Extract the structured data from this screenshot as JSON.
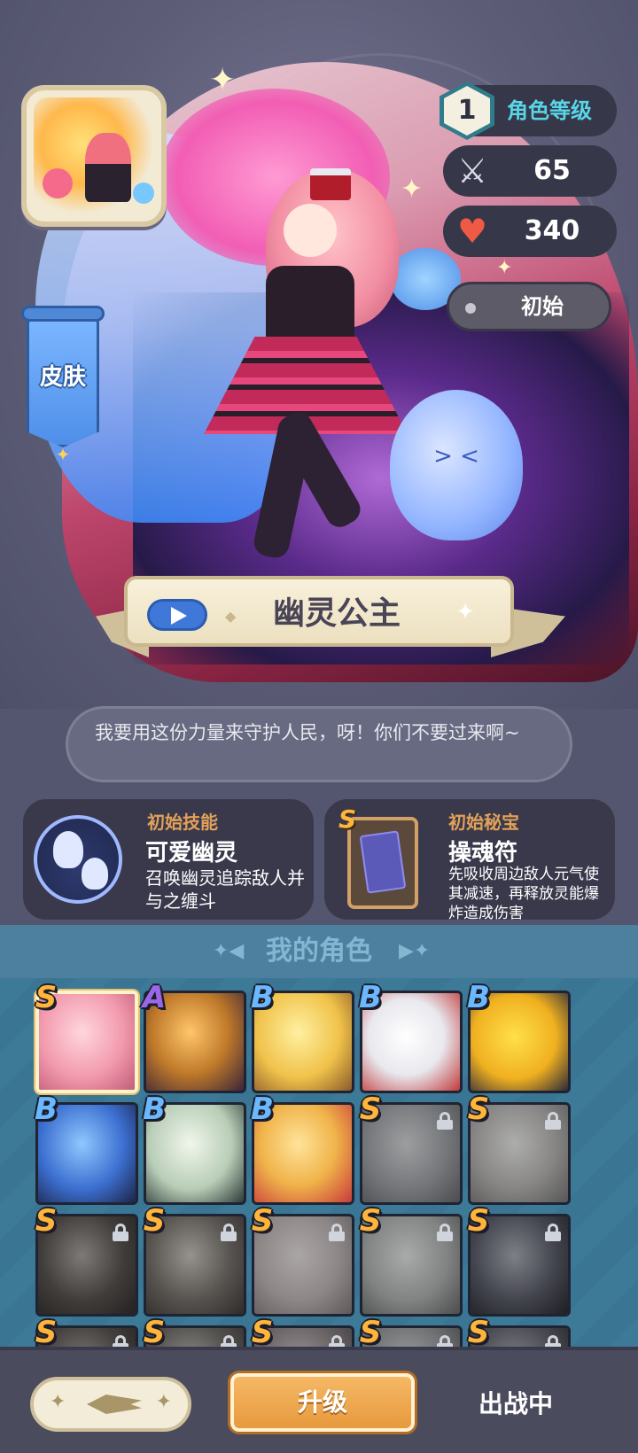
{
  "hero": {
    "level_number": "1",
    "level_label": "角色等级",
    "attack": "65",
    "hp": "340",
    "state": "初始",
    "skin_label": "皮肤",
    "name": "幽灵公主",
    "quote": "我要用这份力量来守护人民，呀！你们不要过来啊~"
  },
  "skill": {
    "label": "初始技能",
    "title": "可爱幽灵",
    "desc": "召唤幽灵追踪敌人并与之缠斗"
  },
  "treasure": {
    "label": "初始秘宝",
    "grade": "S",
    "title": "操魂符",
    "desc": "先吸收周边敌人元气使其减速，再释放灵能爆炸造成伤害"
  },
  "roster": {
    "title": "我的角色",
    "characters": [
      {
        "grade": "S",
        "locked": false,
        "selected": true
      },
      {
        "grade": "A",
        "locked": false,
        "selected": false
      },
      {
        "grade": "B",
        "locked": false,
        "selected": false
      },
      {
        "grade": "B",
        "locked": false,
        "selected": false
      },
      {
        "grade": "B",
        "locked": false,
        "selected": false
      },
      {
        "grade": "B",
        "locked": false,
        "selected": false
      },
      {
        "grade": "B",
        "locked": false,
        "selected": false
      },
      {
        "grade": "B",
        "locked": false,
        "selected": false
      },
      {
        "grade": "S",
        "locked": true,
        "selected": false
      },
      {
        "grade": "S",
        "locked": true,
        "selected": false
      },
      {
        "grade": "S",
        "locked": true,
        "selected": false
      },
      {
        "grade": "S",
        "locked": true,
        "selected": false
      },
      {
        "grade": "S",
        "locked": true,
        "selected": false
      },
      {
        "grade": "S",
        "locked": true,
        "selected": false
      },
      {
        "grade": "S",
        "locked": true,
        "selected": false
      },
      {
        "grade": "S",
        "locked": true,
        "selected": false
      },
      {
        "grade": "S",
        "locked": true,
        "selected": false
      },
      {
        "grade": "S",
        "locked": true,
        "selected": false
      },
      {
        "grade": "S",
        "locked": true,
        "selected": false
      },
      {
        "grade": "S",
        "locked": true,
        "selected": false
      }
    ]
  },
  "footer": {
    "upgrade_label": "升级",
    "deploy_label": "出战中"
  },
  "colors": {
    "grade_S": "#ffb43a",
    "grade_A": "#9a67e8",
    "grade_B": "#6ab8ff",
    "accent_orange": "#e79a3d",
    "level_cyan": "#58d6e6"
  }
}
